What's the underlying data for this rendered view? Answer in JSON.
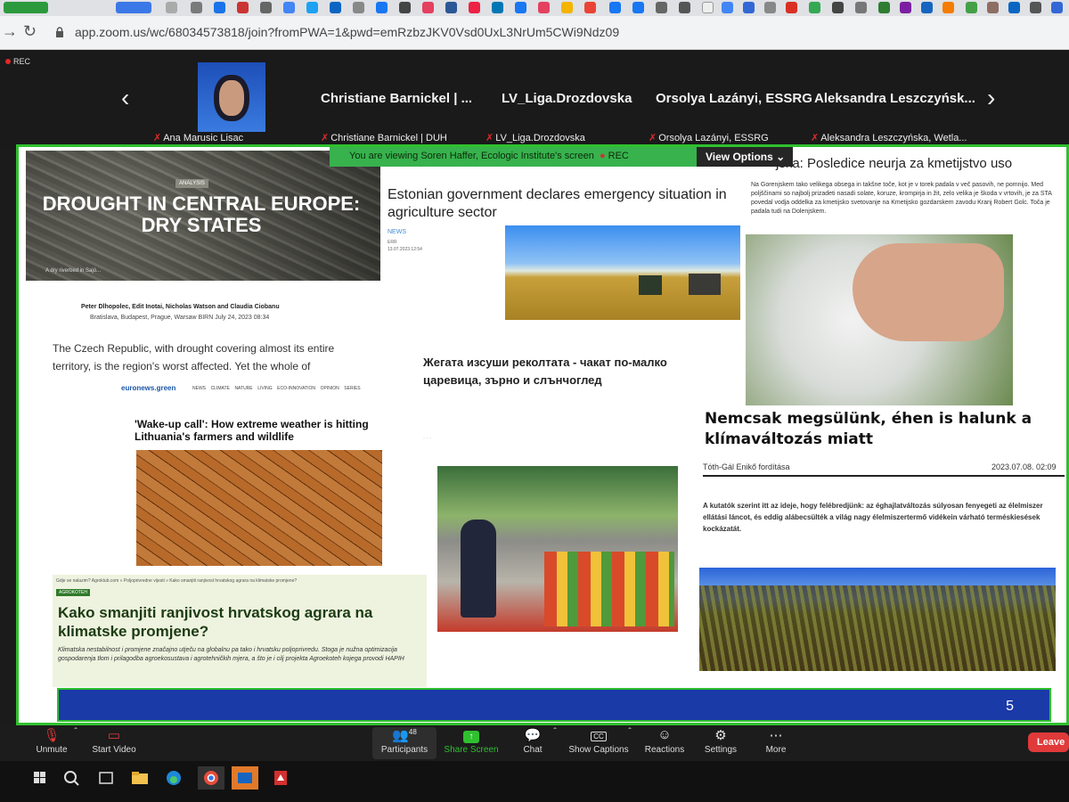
{
  "browser": {
    "url": "app.zoom.us/wc/68034573818/join?fromPWA=1&pwd=emRzbzJKV0Vsd0UxL3NrUm5CWi9Ndz09",
    "back_icon": "back-arrow-icon",
    "reload_icon": "reload-icon"
  },
  "zoom": {
    "rec_label": "REC",
    "participants_strip": [
      {
        "tile_label": "Christiane Barnickel | ...",
        "name": "Christiane Barnickel | DUH"
      },
      {
        "tile_label": "LV_Liga.Drozdovska",
        "name": "LV_Liga.Drozdovska"
      },
      {
        "tile_label": "Orsolya Lazányi, ESSRG",
        "name": "Orsolya Lazányi, ESSRG"
      },
      {
        "tile_label": "Aleksandra Leszczyńsk...",
        "name": "Aleksandra Leszczyńska, Wetla..."
      }
    ],
    "self_name": "Ana Marusic Lisac",
    "viewing_text": "You are viewing  Soren Haffer, Ecologic Institute's screen",
    "viewing_rec": "REC",
    "view_options": "View Options",
    "page_number": "5"
  },
  "articles": {
    "drought": {
      "badge": "ANALYSIS",
      "title": "DROUGHT IN CENTRAL EUROPE: DRY STATES",
      "caption": "A dry riverbed in Sajó...",
      "authors_line": "Peter Dlhopolec, Edit Inotai, Nicholas Watson and Claudia Ciobanu",
      "meta_line": "Bratislava, Budapest, Prague, Warsaw   BIRN   July 24, 2023  08:34",
      "lead": "The Czech Republic, with drought covering almost its entire territory, is the region's worst affected. Yet the whole of Central"
    },
    "estonia": {
      "title": "Estonian government declares emergency situation in agriculture sector",
      "tag": "NEWS",
      "source": "ERR",
      "date": "13.07.2023 12:54"
    },
    "slovenia": {
      "title": "jska: Posledice neurja za kmetijstvo uso",
      "body": "Na Gorenjskem tako velikega obsega in takšne toče, kot je v torek padala v več pasovih, ne pomnijo. Med poljščinami so najbolj prizadeti nasadi solate, koruze, krompirja in žit, zelo velika je škoda v vrtovih, je za STA povedal vodja oddelka za kmetijsko svetovanje na Kmetijsko gozdarskem zavodu Kranj Robert Golc. Toča je padala tudi na Dolenjskem."
    },
    "bulgaria": {
      "title": "Жегата изсуши реколтата - чакат по-малко царевица, зърно и слънчоглед"
    },
    "euronews": {
      "logo": "euronews.green",
      "nav": [
        "NEWS",
        "CLIMATE",
        "NATURE",
        "LIVING",
        "ECO-INNOVATION",
        "OPINION",
        "SERIES"
      ],
      "title": "'Wake-up call': How extreme weather is hitting Lithuania's farmers and wildlife"
    },
    "hungary": {
      "title": "Nemcsak megsülünk, éhen is halunk a klímaváltozás miatt",
      "byline": "Tóth-Gál Enikő fordítása",
      "date": "2023.07.08. 02:09",
      "body": "A kutatók szerint itt az ideje, hogy felébredjünk: az éghajlatváltozás súlyosan fenyegeti az élelmiszer ellátási láncot, és eddig alábecsülték a világ nagy élelmiszertermő vidékein várható terméskiesések kockázatát."
    },
    "croatia": {
      "breadcrumb": "Gdje se nalazim?  Agroklub.com  »  Poljoprivredne vijesti  »  Kako smanjiti ranjivost hrvatskog agrara na klimatske promjene?",
      "tag": "AGROKOTEH",
      "title": "Kako smanjiti ranjivost hrvatskog agrara na klimatske promjene?",
      "body": "Klimatska nestabilnost i promjene značajno utječu na globalnu pa tako i hrvatsku poljoprivredu. Stoga je nužna optimizacija gospodarenja tlom i prilagodba agroekosustava i agrotehničkih mjera, a što je i cilj projekta Agroekoteh kojega provodi HAPIH"
    }
  },
  "toolbar": {
    "items": [
      {
        "label": "Unmute",
        "icon": "muted-mic-icon"
      },
      {
        "label": "Start Video",
        "icon": "video-off-icon"
      },
      {
        "label": "Participants",
        "icon": "participants-icon",
        "badge": "48"
      },
      {
        "label": "Share Screen",
        "icon": "share-screen-icon"
      },
      {
        "label": "Chat",
        "icon": "chat-icon"
      },
      {
        "label": "Show Captions",
        "icon": "captions-icon"
      },
      {
        "label": "Reactions",
        "icon": "reactions-icon"
      },
      {
        "label": "Settings",
        "icon": "settings-icon"
      },
      {
        "label": "More",
        "icon": "more-icon"
      }
    ],
    "leave": "Leave"
  },
  "colors": {
    "share_border": "#2fc02f",
    "viewing_green": "#37b24d",
    "leave_red": "#e03a3a",
    "share_screen_green": "#2fc02f"
  }
}
